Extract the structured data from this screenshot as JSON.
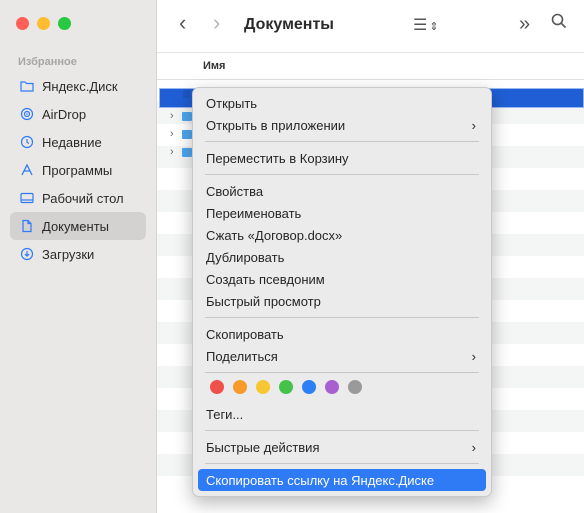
{
  "sidebar": {
    "header": "Избранное",
    "items": [
      {
        "label": "Яндекс.Диск",
        "icon": "folder-icon"
      },
      {
        "label": "AirDrop",
        "icon": "airdrop-icon"
      },
      {
        "label": "Недавние",
        "icon": "clock-icon"
      },
      {
        "label": "Программы",
        "icon": "apps-icon"
      },
      {
        "label": "Рабочий стол",
        "icon": "desktop-icon"
      },
      {
        "label": "Документы",
        "icon": "document-icon",
        "active": true
      },
      {
        "label": "Загрузки",
        "icon": "download-icon"
      }
    ]
  },
  "toolbar": {
    "back": "‹",
    "forward": "›",
    "title": "Документы",
    "view": "☰",
    "more": "»",
    "search": "⌕"
  },
  "columns": {
    "name": "Имя"
  },
  "menu": {
    "open": "Открыть",
    "open_with": "Открыть в приложении",
    "trash": "Переместить в Корзину",
    "info": "Свойства",
    "rename": "Переименовать",
    "compress": "Сжать «Договор.docx»",
    "duplicate": "Дублировать",
    "alias": "Создать псевдоним",
    "quicklook": "Быстрый просмотр",
    "copy": "Скопировать",
    "share": "Поделиться",
    "tags_label": "Теги...",
    "quick_actions": "Быстрые действия",
    "yandex_link": "Скопировать ссылку на Яндекс.Диске",
    "submenu_arrow": "›"
  },
  "tag_colors": [
    "#f0504a",
    "#f69a2a",
    "#f7c630",
    "#45c24a",
    "#2b80f6",
    "#a75fd2",
    "#9a9a9a"
  ]
}
